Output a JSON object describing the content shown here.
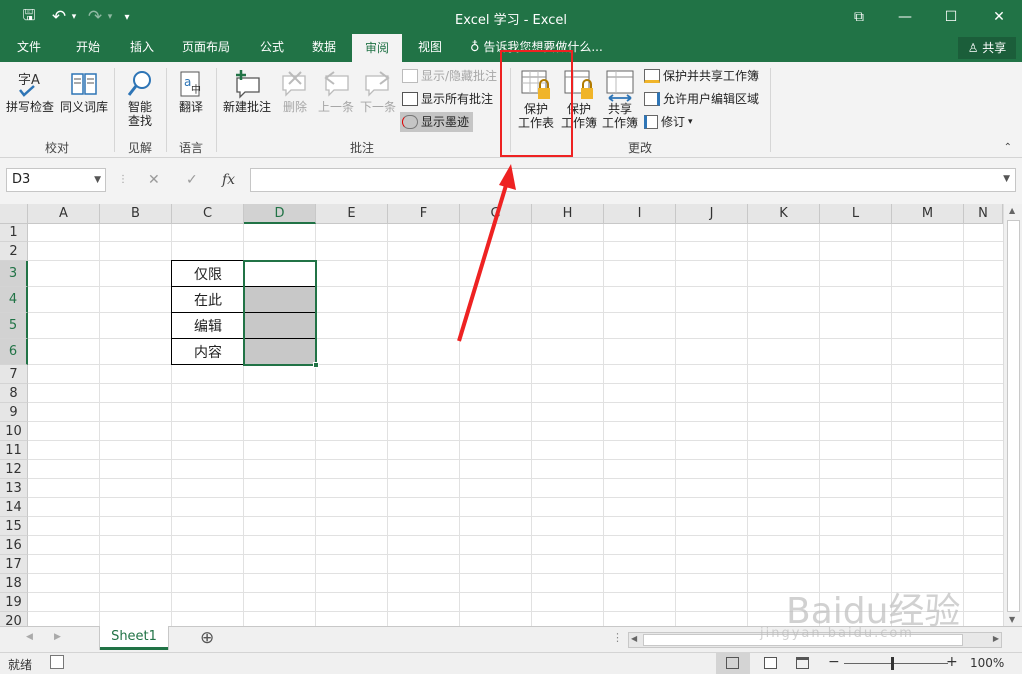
{
  "window": {
    "title": "Excel 学习 - Excel",
    "qa_save": "🖫",
    "qa_undo": "↶",
    "qa_redo": "↷",
    "qa_more": "▾",
    "restore_icon": "⧉",
    "min_icon": "—",
    "max_icon": "☐",
    "close_icon": "✕"
  },
  "tabs": [
    "文件",
    "开始",
    "插入",
    "页面布局",
    "公式",
    "数据",
    "审阅",
    "视图"
  ],
  "active_tab": "审阅",
  "tell_me": "告诉我您想要做什么...",
  "share_label": "共享",
  "ribbon": {
    "groups": {
      "proofing": "校对",
      "insights": "见解",
      "language": "语言",
      "comments": "批注",
      "changes": "更改"
    },
    "spell_check": "拼写检查",
    "thesaurus": "同义词库",
    "smart_lookup_1": "智能",
    "smart_lookup_2": "查找",
    "translate": "翻译",
    "new_comment": "新建批注",
    "delete": "删除",
    "previous": "上一条",
    "next": "下一条",
    "show_hide_comment": "显示/隐藏批注",
    "show_all_comments": "显示所有批注",
    "show_ink": "显示墨迹",
    "protect_sheet_1": "保护",
    "protect_sheet_2": "工作表",
    "protect_workbook_1": "保护",
    "protect_workbook_2": "工作簿",
    "share_workbook_1": "共享",
    "share_workbook_2": "工作簿",
    "protect_share_workbook": "保护并共享工作簿",
    "allow_edit_ranges": "允许用户编辑区域",
    "track_changes": "修订",
    "track_changes_caret": "▾",
    "collapse": "⌃"
  },
  "formula_bar": {
    "name_box": "D3",
    "cancel": "✕",
    "enter": "✓",
    "fx": "fx",
    "value": ""
  },
  "columns": [
    "A",
    "B",
    "C",
    "D",
    "E",
    "F",
    "G",
    "H",
    "I",
    "J",
    "K",
    "L",
    "M",
    "N"
  ],
  "rows": [
    "1",
    "2",
    "3",
    "4",
    "5",
    "6",
    "7",
    "8",
    "9",
    "10",
    "11",
    "12",
    "13",
    "14",
    "15",
    "16",
    "17",
    "18",
    "19",
    "20"
  ],
  "cells": {
    "C3": "仅限",
    "C4": "在此",
    "C5": "编辑",
    "C6": "内容"
  },
  "sheet_tab": "Sheet1",
  "add_sheet": "⊕",
  "status": {
    "ready": "就绪",
    "zoom": "100%",
    "zoom_minus": "−",
    "zoom_plus": "+"
  },
  "watermark": "Baidu经验",
  "watermark_url": "jingyan.baidu.com"
}
